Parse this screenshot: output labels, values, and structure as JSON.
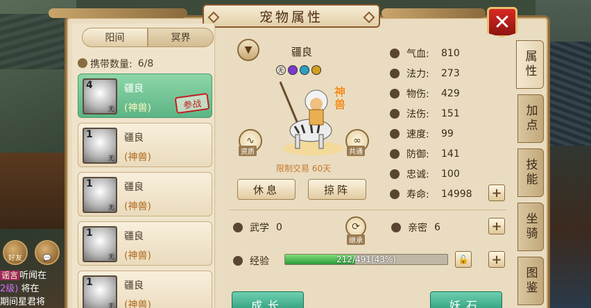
{
  "window": {
    "title": "宠物属性"
  },
  "realm_tabs": [
    {
      "label": "阳间"
    },
    {
      "label": "冥界"
    }
  ],
  "carry": {
    "label": "携带数量:",
    "value": "6/8"
  },
  "pets": [
    {
      "level": "4",
      "sub": "无",
      "name": "疆良",
      "type": "(神兽)",
      "selected": true,
      "badge": "参战"
    },
    {
      "level": "1",
      "sub": "无",
      "name": "疆良",
      "type": "(神兽)"
    },
    {
      "level": "1",
      "sub": "无",
      "name": "疆良",
      "type": "(神兽)"
    },
    {
      "level": "1",
      "sub": "无",
      "name": "疆良",
      "type": "(神兽)"
    },
    {
      "level": "1",
      "sub": "无",
      "name": "疆良",
      "type": "(神兽)"
    }
  ],
  "detail": {
    "name": "疆良",
    "element_badge": "无",
    "divine_label": "神兽",
    "left_btn_label": "资质",
    "right_btn_label": "共通",
    "restriction": "限制交易 60天",
    "rest_btn": "休息",
    "battle_btn": "掠阵",
    "inherit_label": "继承"
  },
  "stats": [
    {
      "icon": "heart-icon",
      "label": "气血:",
      "value": "810"
    },
    {
      "icon": "mana-drop-icon",
      "label": "法力:",
      "value": "273"
    },
    {
      "icon": "sword-icon",
      "label": "物伤:",
      "value": "429"
    },
    {
      "icon": "flame-icon",
      "label": "法伤:",
      "value": "151"
    },
    {
      "icon": "lightning-icon",
      "label": "速度:",
      "value": "99"
    },
    {
      "icon": "shield-icon",
      "label": "防御:",
      "value": "141"
    },
    {
      "icon": "handshake-icon",
      "label": "忠诚:",
      "value": "100"
    },
    {
      "icon": "hourglass-icon",
      "label": "寿命:",
      "value": "14998"
    }
  ],
  "wuxue": {
    "label": "武学",
    "value": "0"
  },
  "intimacy": {
    "label": "亲密",
    "value": "6"
  },
  "exp": {
    "label": "经验",
    "text": "212/491(43%)",
    "progress": 0.43
  },
  "bottom_buttons": {
    "grow": "成长",
    "demon_stone": "妖石"
  },
  "side_tabs": [
    {
      "label": "属性"
    },
    {
      "label": "加点"
    },
    {
      "label": "技能"
    },
    {
      "label": "坐骑"
    },
    {
      "label": "图鉴"
    }
  ],
  "chat": {
    "friend_label": "好友",
    "line1_tag": "谣言",
    "line1": "听闻在",
    "line2_a": "2级)",
    "line2_b": "将在",
    "line3": "期间星君将"
  },
  "colors": {
    "accent_green": "#5cb486",
    "close_red": "#c8201a",
    "panel_bg": "#e9dcc0"
  }
}
